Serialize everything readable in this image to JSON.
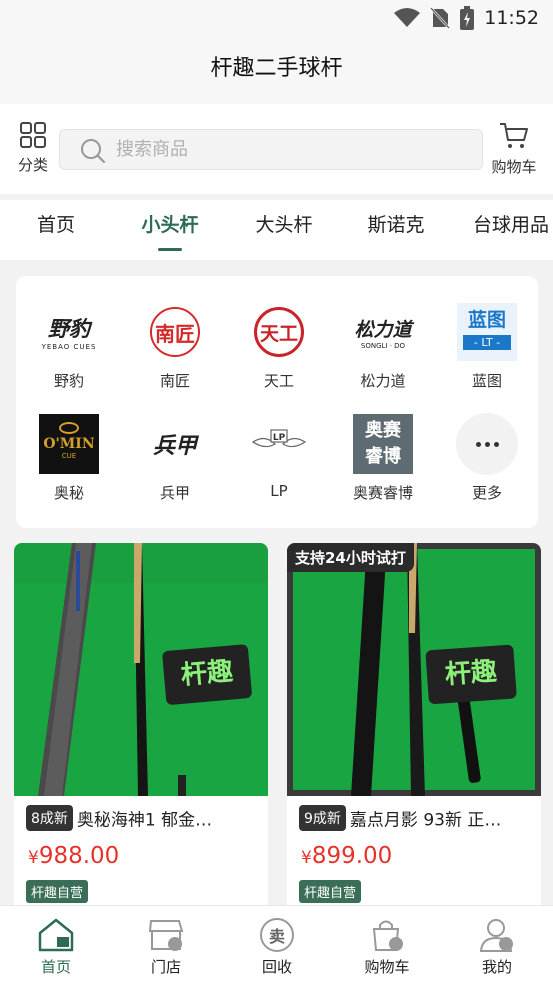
{
  "status_bar": {
    "time": "11:52"
  },
  "header": {
    "title": "杆趣二手球杆"
  },
  "search": {
    "category_label": "分类",
    "placeholder": "搜索商品",
    "cart_label": "购物车"
  },
  "tabs": [
    {
      "label": "首页"
    },
    {
      "label": "小头杆",
      "active": true
    },
    {
      "label": "大头杆"
    },
    {
      "label": "斯诺克"
    },
    {
      "label": "台球用品"
    }
  ],
  "brands": [
    {
      "name": "野豹",
      "logo_text": "野豹",
      "logo_sub": "YEBAO CUES",
      "icon": "yebao-logo"
    },
    {
      "name": "南匠",
      "logo_text": "南匠",
      "icon": "nanjiang-logo"
    },
    {
      "name": "天工",
      "logo_text": "天工",
      "icon": "tiangong-logo"
    },
    {
      "name": "松力道",
      "logo_text": "松力道",
      "logo_sub": "SONGLI · DO",
      "icon": "songlidao-logo"
    },
    {
      "name": "蓝图",
      "logo_text": "蓝图",
      "logo_sub": "- LT -",
      "icon": "lantu-logo"
    },
    {
      "name": "奥秘",
      "logo_text": "O'MIN",
      "logo_sub": "CUE",
      "icon": "omin-logo"
    },
    {
      "name": "兵甲",
      "logo_text": "兵甲",
      "icon": "bingjia-logo"
    },
    {
      "name": "LP",
      "logo_text": "LP",
      "icon": "lp-logo"
    },
    {
      "name": "奥赛睿博",
      "logo_text": "奥赛",
      "logo_text2": "睿博",
      "icon": "aosai-logo"
    },
    {
      "name": "更多",
      "icon": "more-icon"
    }
  ],
  "products": [
    {
      "condition": "8成新",
      "title": "奥秘海神1 郁金…",
      "currency": "¥",
      "price": "988.00",
      "tag": "杆趣自营",
      "photo_text": "杆趣"
    },
    {
      "condition": "9成新",
      "title": "嘉点月影 93新 正…",
      "currency": "¥",
      "price": "899.00",
      "tag": "杆趣自营",
      "badge": "支持24小时试打",
      "photo_text": "杆趣"
    }
  ],
  "bottom_nav": [
    {
      "label": "首页",
      "icon": "home-icon",
      "active": true
    },
    {
      "label": "门店",
      "icon": "store-icon"
    },
    {
      "label": "回收",
      "icon": "recycle-icon",
      "glyph": "卖"
    },
    {
      "label": "购物车",
      "icon": "cart-icon"
    },
    {
      "label": "我的",
      "icon": "profile-icon"
    }
  ],
  "colors": {
    "accent": "#2d6b52",
    "price": "#e5332b",
    "felt": "#1aa543"
  }
}
